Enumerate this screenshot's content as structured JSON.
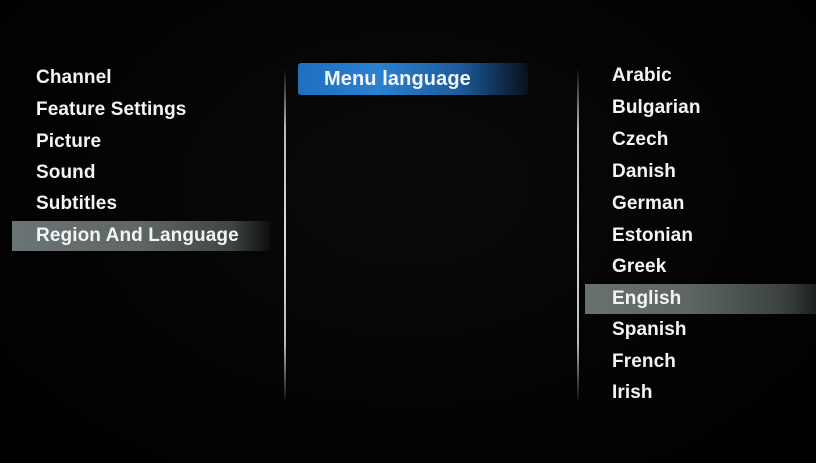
{
  "main_menu": {
    "items": [
      {
        "label": "Channel"
      },
      {
        "label": "Feature Settings"
      },
      {
        "label": "Picture"
      },
      {
        "label": "Sound"
      },
      {
        "label": "Subtitles"
      },
      {
        "label": "Region And Language"
      }
    ],
    "selected_index": 5
  },
  "submenu": {
    "items": [
      {
        "label": "Menu language"
      }
    ],
    "highlighted_index": 0
  },
  "options": {
    "items": [
      {
        "label": "Arabic"
      },
      {
        "label": "Bulgarian"
      },
      {
        "label": "Czech"
      },
      {
        "label": "Danish"
      },
      {
        "label": "German"
      },
      {
        "label": "Estonian"
      },
      {
        "label": "Greek"
      },
      {
        "label": "English"
      },
      {
        "label": "Spanish"
      },
      {
        "label": "French"
      },
      {
        "label": "Irish"
      }
    ],
    "selected_index": 7
  },
  "colors": {
    "background": "#000000",
    "highlight_blue": "#2a80d2",
    "selection_grey": "#5e6666",
    "text": "#f4f4f4"
  }
}
